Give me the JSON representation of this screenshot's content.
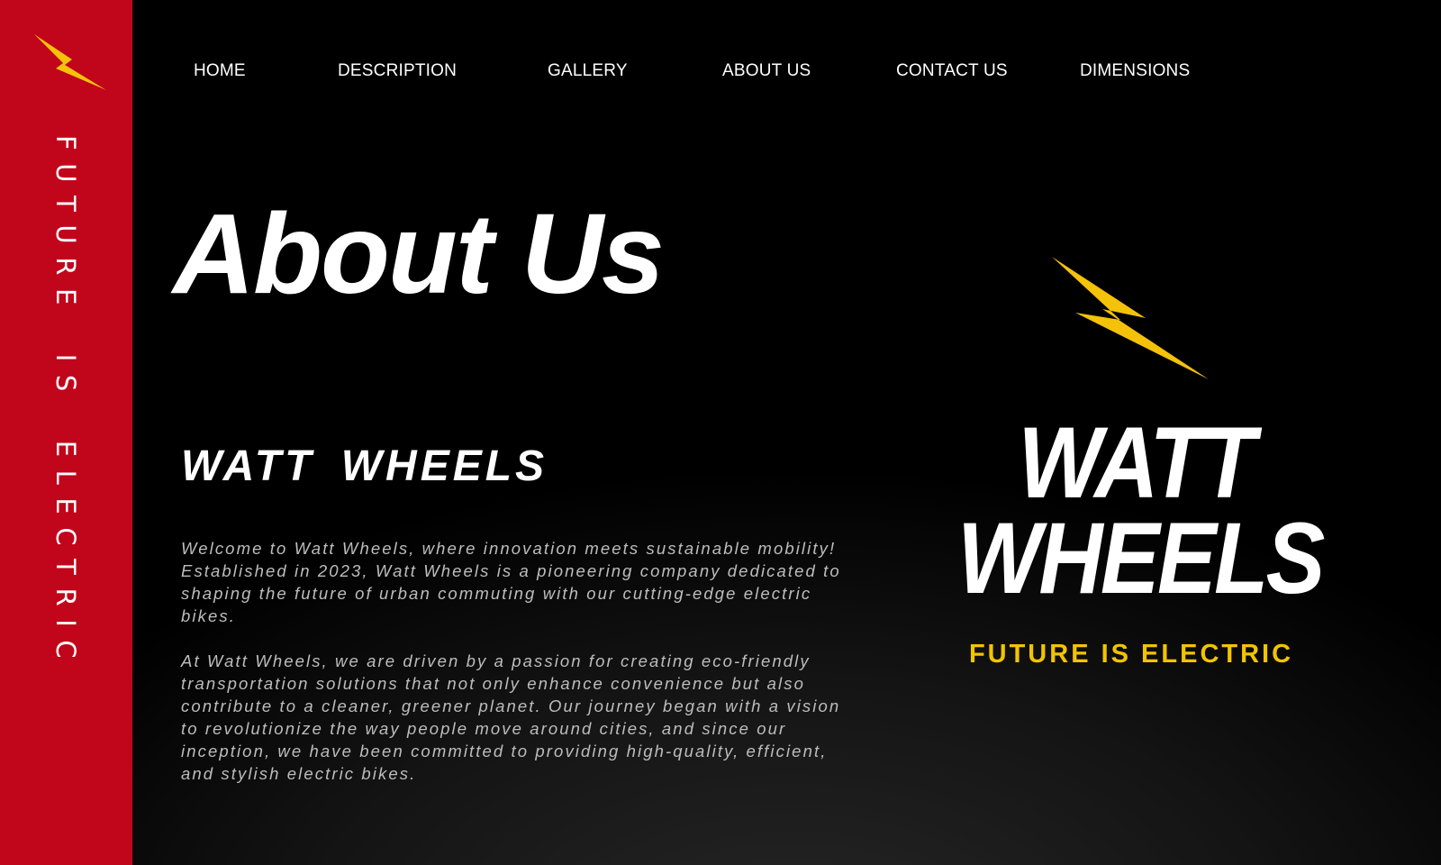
{
  "colors": {
    "sidebar": "#c1061b",
    "background": "#000000",
    "accent": "#f5c20a",
    "text": "#ffffff",
    "body_text": "#bdbdbd"
  },
  "sidebar": {
    "icon": "lightning-bolt-icon",
    "tagline": "FUTURE IS ELECTRIC"
  },
  "nav": {
    "items": [
      {
        "label": "HOME"
      },
      {
        "label": "DESCRIPTION"
      },
      {
        "label": "GALLERY"
      },
      {
        "label": "ABOUT US"
      },
      {
        "label": "CONTACT US"
      },
      {
        "label": "DIMENSIONS"
      }
    ]
  },
  "main": {
    "title": "About Us",
    "brand_heading": "WATT  WHEELS",
    "paragraphs": [
      "Welcome to Watt Wheels, where innovation meets sustainable mobility! Established in 2023, Watt Wheels is a pioneering company dedicated to shaping the future of urban commuting with our cutting-edge electric bikes.",
      "At Watt Wheels, we are driven by a passion for creating eco-friendly transportation solutions that not only enhance convenience but also contribute to a cleaner, greener planet. Our journey began with a vision to revolutionize the way people move around cities, and since our inception, we have been committed to providing high-quality, efficient, and stylish electric bikes."
    ]
  },
  "logo": {
    "icon": "lightning-bolt-icon",
    "line1": "WATT",
    "line2": "WHEELS",
    "tagline": "FUTURE IS ELECTRIC"
  }
}
